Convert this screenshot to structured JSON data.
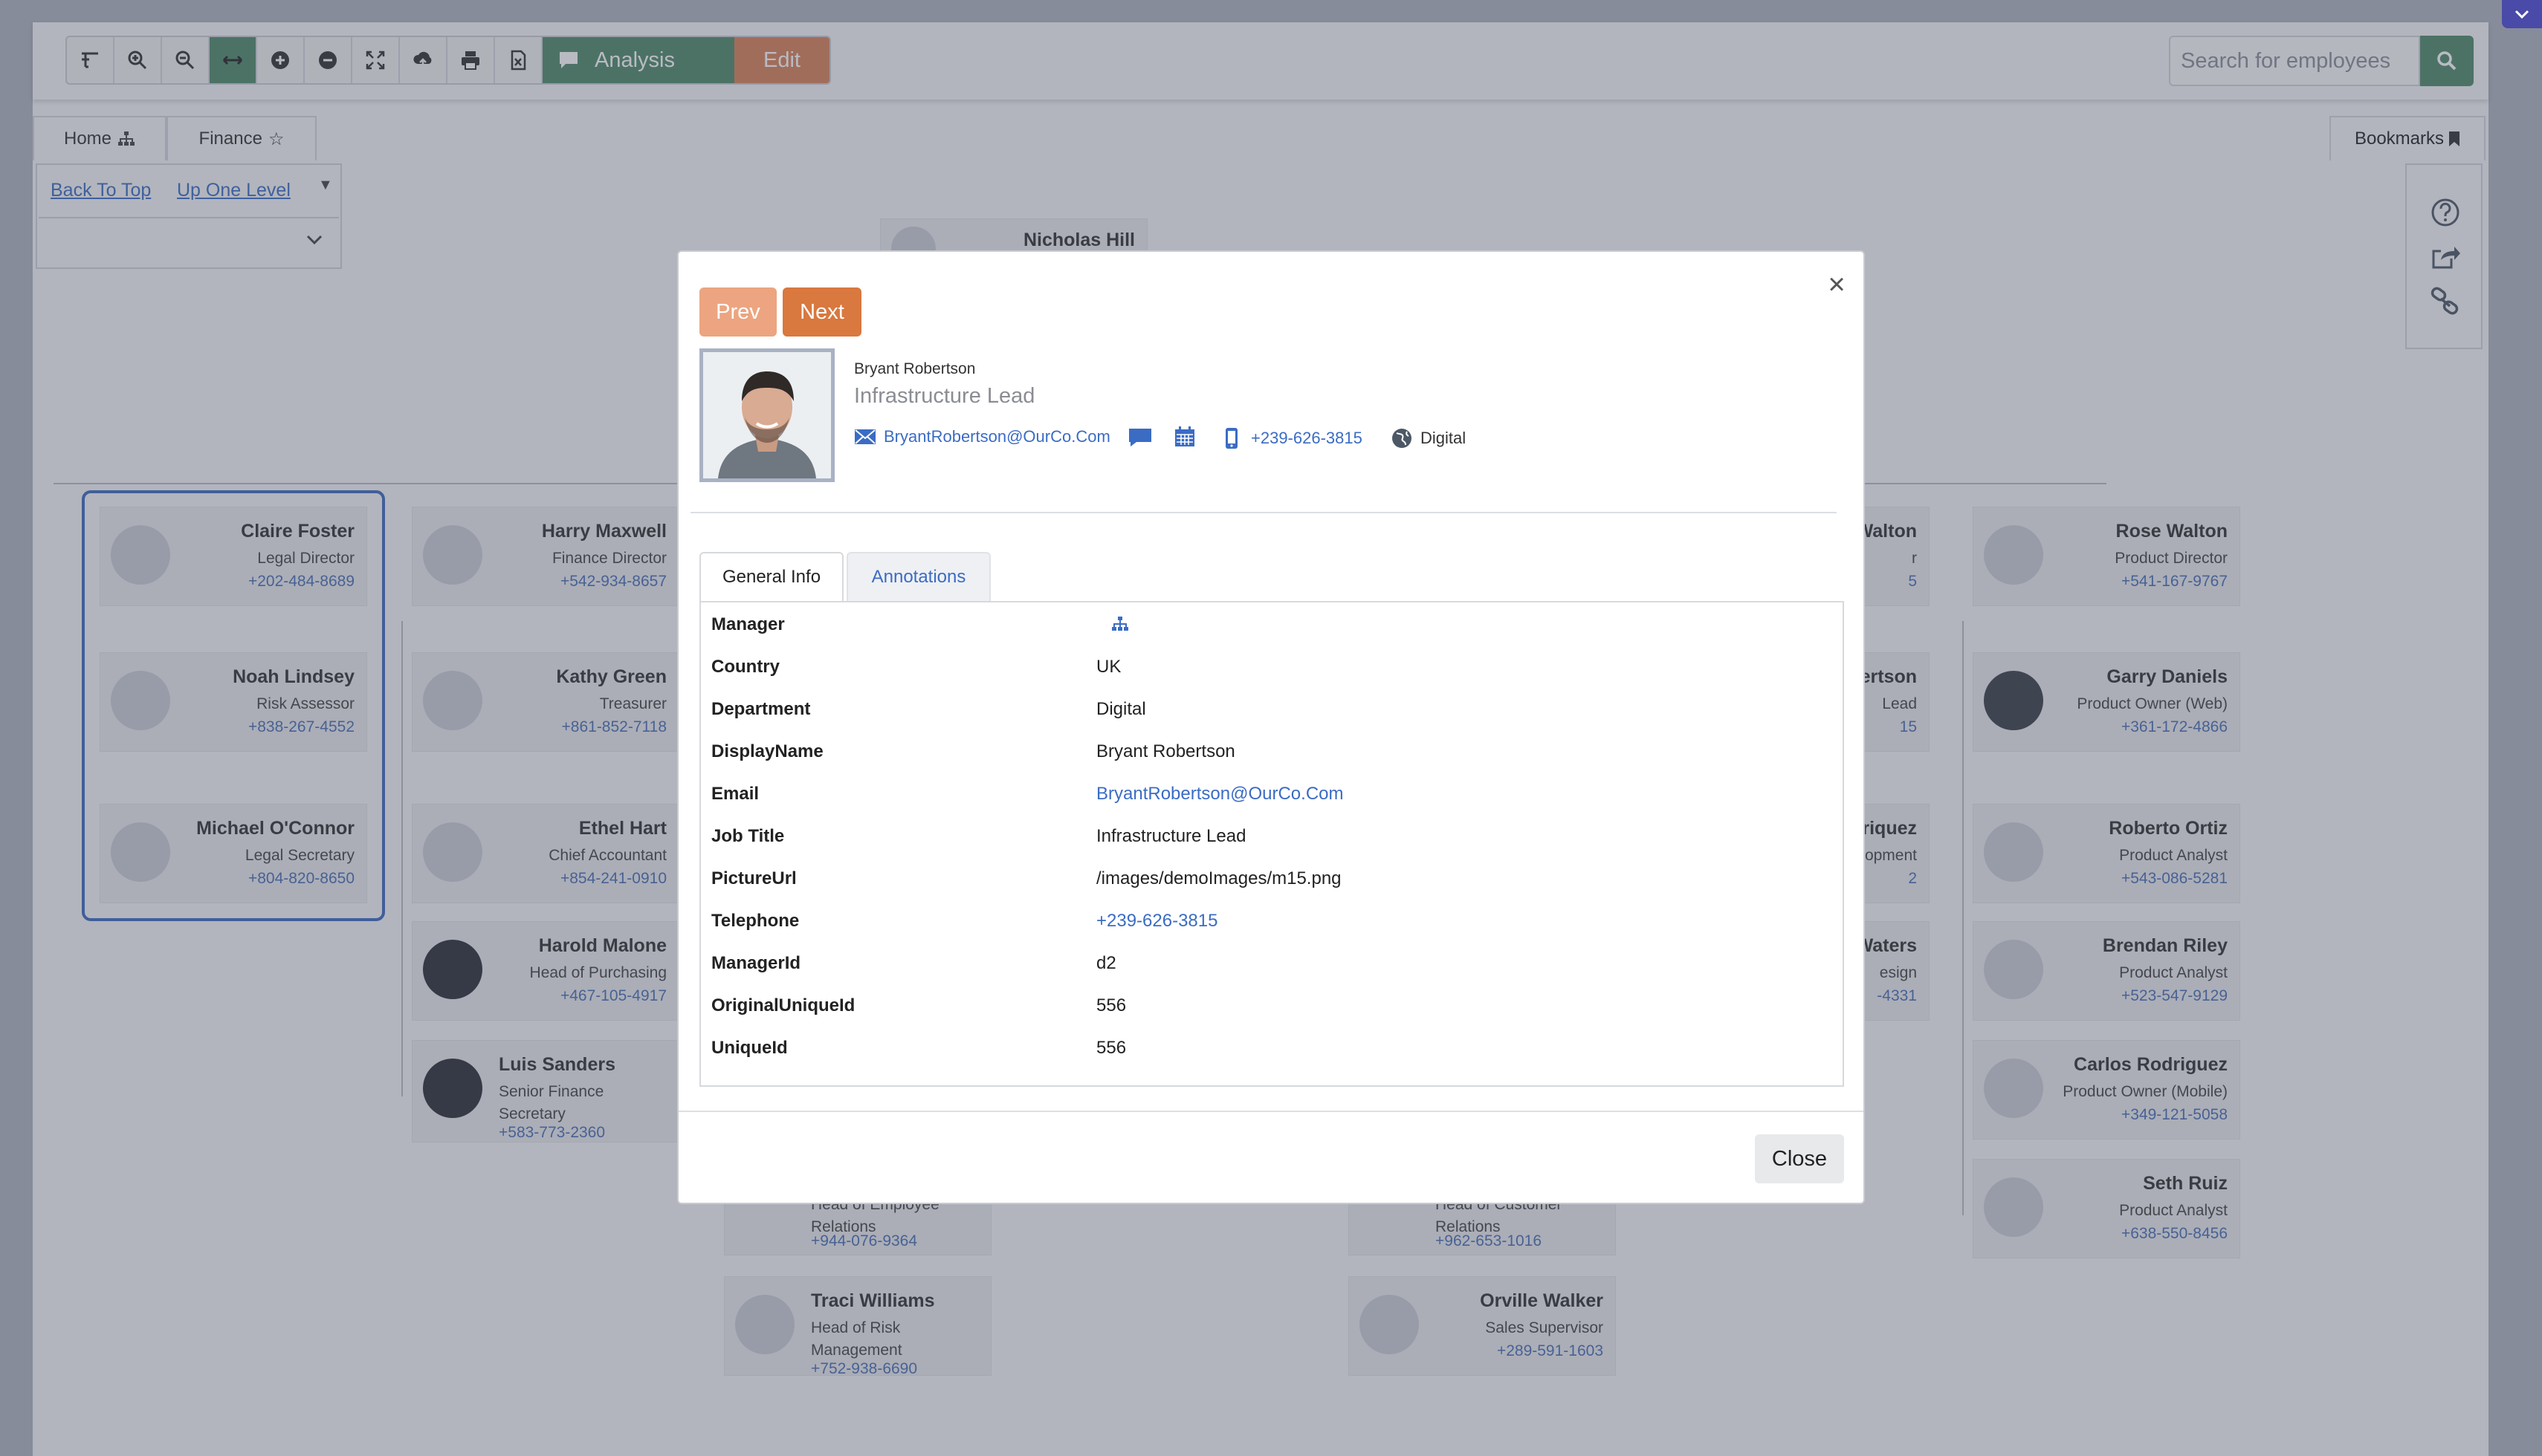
{
  "toolbar": {
    "icons": [
      "text-size-icon",
      "zoom-in-icon",
      "zoom-out-icon",
      "fit-width-icon",
      "expand-icon",
      "collapse-icon",
      "fullscreen-icon",
      "upload-icon",
      "print-icon",
      "excel-icon"
    ],
    "analysis_label": "Analysis",
    "edit_label": "Edit",
    "search_placeholder": "Search for employees",
    "accent_green": "#4f8a6b",
    "accent_orange": "#d9825a"
  },
  "tabs": [
    {
      "label": "Home",
      "icon": "sitemap-icon"
    },
    {
      "label": "Finance",
      "icon": "star-icon"
    }
  ],
  "bookmarks_label": "Bookmarks",
  "nav": {
    "back_to_top": "Back To Top",
    "up_one_level": "Up One Level"
  },
  "chart": {
    "top_name": "Nicholas Hill",
    "cards": [
      {
        "name": "Claire Foster",
        "title": "Legal Director",
        "tel": "+202-484-8689"
      },
      {
        "name": "Noah Lindsey",
        "title": "Risk Assessor",
        "tel": "+838-267-4552"
      },
      {
        "name": "Michael O'Connor",
        "title": "Legal Secretary",
        "tel": "+804-820-8650"
      },
      {
        "name": "Harry Maxwell",
        "title": "Finance Director",
        "tel": "+542-934-8657"
      },
      {
        "name": "Kathy Green",
        "title": "Treasurer",
        "tel": "+861-852-7118"
      },
      {
        "name": "Ethel Hart",
        "title": "Chief Accountant",
        "tel": "+854-241-0910"
      },
      {
        "name": "Harold Malone",
        "title": "Head of Purchasing",
        "tel": "+467-105-4917"
      },
      {
        "name": "Luis Sanders",
        "title": "Senior Finance Secretary",
        "tel": "+583-773-2360"
      },
      {
        "name": "Rose Walton",
        "title": "Product Director",
        "tel": "+541-167-9767"
      },
      {
        "name": "Garry Daniels",
        "title": "Product Owner (Web)",
        "tel": "+361-172-4866"
      },
      {
        "name": "Roberto Ortiz",
        "title": "Product Analyst",
        "tel": "+543-086-5281"
      },
      {
        "name": "Brendan Riley",
        "title": "Product Analyst",
        "tel": "+523-547-9129"
      },
      {
        "name": "Carlos Rodriguez",
        "title": "Product Owner (Mobile)",
        "tel": "+349-121-5058"
      },
      {
        "name": "Seth Ruiz",
        "title": "Product Analyst",
        "tel": "+638-550-8456"
      },
      {
        "name": "Traci Williams",
        "title": "Head of Risk Management",
        "tel": "+752-938-6690"
      },
      {
        "name": "Orville Walker",
        "title": "Sales Supervisor",
        "tel": "+289-591-1603"
      },
      {
        "name": "",
        "title": "Head of Employee Relations",
        "tel": "+944-076-9364"
      },
      {
        "name": "",
        "title": "Head of Customer Relations",
        "tel": "+962-653-1016"
      },
      {
        "name": "Walton",
        "title": "r",
        "tel": "5"
      },
      {
        "name": "ertson",
        "title": "Lead",
        "tel": "15"
      },
      {
        "name": "riquez",
        "title": "opment",
        "tel": "2"
      },
      {
        "name": "Waters",
        "title": "esign",
        "tel": "-4331"
      }
    ]
  },
  "modal": {
    "prev_label": "Prev",
    "next_label": "Next",
    "name": "Bryant Robertson",
    "job_title": "Infrastructure Lead",
    "email": "BryantRobertson@OurCo.Com",
    "phone": "+239-626-3815",
    "department": "Digital",
    "tabs": [
      "General Info",
      "Annotations"
    ],
    "fields": [
      {
        "key": "Manager",
        "value": ""
      },
      {
        "key": "Country",
        "value": "UK"
      },
      {
        "key": "Department",
        "value": "Digital"
      },
      {
        "key": "DisplayName",
        "value": "Bryant Robertson"
      },
      {
        "key": "Email",
        "value": "BryantRobertson@OurCo.Com"
      },
      {
        "key": "Job Title",
        "value": "Infrastructure Lead"
      },
      {
        "key": "PictureUrl",
        "value": "/images/demoImages/m15.png"
      },
      {
        "key": "Telephone",
        "value": "+239-626-3815"
      },
      {
        "key": "ManagerId",
        "value": "d2"
      },
      {
        "key": "OriginalUniqueId",
        "value": "556"
      },
      {
        "key": "UniqueId",
        "value": "556"
      }
    ],
    "close_label": "Close"
  }
}
